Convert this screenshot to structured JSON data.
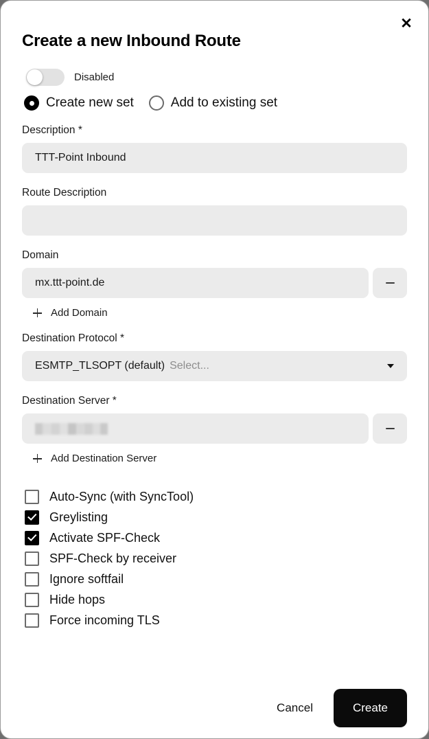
{
  "dialog": {
    "title": "Create a new Inbound Route",
    "close_icon": "close-icon"
  },
  "enable_toggle": {
    "label": "Disabled",
    "state": "off"
  },
  "set_mode": {
    "options": [
      {
        "label": "Create new set",
        "selected": true
      },
      {
        "label": "Add to existing set",
        "selected": false
      }
    ]
  },
  "description": {
    "label": "Description *",
    "value": "TTT-Point Inbound",
    "placeholder": ""
  },
  "route_description": {
    "label": "Route Description",
    "value": "",
    "placeholder": ""
  },
  "domain": {
    "label": "Domain",
    "value": "mx.ttt-point.de",
    "remove_icon": "minus-icon",
    "add_label": "Add Domain",
    "add_icon": "plus-icon"
  },
  "destination_protocol": {
    "label": "Destination Protocol *",
    "value": "ESMTP_TLSOPT (default)",
    "placeholder": "Select...",
    "caret_icon": "chevron-down-icon"
  },
  "destination_server": {
    "label": "Destination Server *",
    "value": "",
    "redacted": true,
    "remove_icon": "minus-icon",
    "add_label": "Add Destination Server",
    "add_icon": "plus-icon"
  },
  "options": [
    {
      "label": "Auto-Sync (with SyncTool)",
      "checked": false
    },
    {
      "label": "Greylisting",
      "checked": true
    },
    {
      "label": "Activate SPF-Check",
      "checked": true
    },
    {
      "label": "SPF-Check by receiver",
      "checked": false
    },
    {
      "label": "Ignore softfail",
      "checked": false
    },
    {
      "label": "Hide hops",
      "checked": false
    },
    {
      "label": "Force incoming TLS",
      "checked": false
    }
  ],
  "footer": {
    "cancel_label": "Cancel",
    "create_label": "Create"
  },
  "colors": {
    "accent": "#0b0b0b",
    "field_bg": "#ebebeb",
    "text": "#111111",
    "placeholder": "#8d8d8d"
  }
}
